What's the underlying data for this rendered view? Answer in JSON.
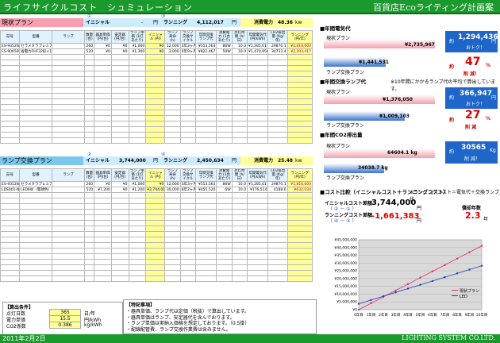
{
  "header": {
    "title": "ライフサイクルコスト　シュミュレーション",
    "right": "百貨店Ecoライティング計画案"
  },
  "footer": {
    "date": "2011年2月2日",
    "company": "LIGHTING SYSTEM CO.LTD."
  },
  "plan1": {
    "name": "現状プラン",
    "initial_label": "イニシャル",
    "initial_value": "-",
    "yen": "円",
    "running_label": "ランニング",
    "running_value": "4,112,017",
    "power_label": "消費電力",
    "power_value": "48.36",
    "kw": "kw",
    "c1": "①",
    "c3": "③",
    "headers": [
      "記号",
      "型番",
      "ランプ",
      "数量 (台)",
      "器具単価 (円/台)",
      "安定器 (円/台)",
      "ランプ単価 (1灯あたり)",
      "イニシャル (円)",
      "ランプ寿命 (h)",
      "ランプ 交換サイクル",
      "年間交換 ランプ代",
      "消費電力 (1台あたり)",
      "点灯時間 (h/日)",
      "年間電気代 (円/kWh)",
      "CO2排出量 (Kg/年)",
      "ランニング (円/年)"
    ],
    "rows": [
      [
        "ES-9352WA",
        "セラメタラプレミアS 70W×1",
        "260",
        "¥0",
        "¥0",
        "¥1,000",
        "¥0",
        "12,000",
        "3年3ヶ月",
        "¥553,563",
        "86W",
        "10.0",
        "¥1,285,017",
        "29870.1",
        "¥1,818,600"
      ],
      [
        "ES-9065B",
        "省電力FHF32形×1灯",
        "520",
        "¥0",
        "¥0",
        "¥1,300",
        "¥0",
        "3,000",
        "0年9ヶ月",
        "¥822,467",
        "50W",
        "10.0",
        "¥1,470,950",
        "34733.4",
        "¥2,293,417"
      ]
    ]
  },
  "plan2": {
    "name": "ランプ交換プラン",
    "initial_label": "イニシャル",
    "initial_value": "3,744,000",
    "yen": "円",
    "running_label": "ランニング",
    "running_value": "2,450,634",
    "power_label": "消費電力",
    "power_value": "25.48",
    "kw": "kw",
    "c2": "②",
    "c4": "④",
    "headers": [
      "記号",
      "型番",
      "ランプ",
      "数量 (台)",
      "器具単価 (円/台)",
      "安定器 (円/台)",
      "ランプ単価 (1灯あたり)",
      "イニシャル (円)",
      "ランプ寿命 (h)",
      "ランプ 交換サイクル",
      "年間交換 ランプ代",
      "消費電力 (1台あたり)",
      "点灯時間 (h/日)",
      "年間電気代 (円/kWh)",
      "CO2排出量 (Kg/年)",
      "ランニング (円/年)"
    ],
    "rows": [
      [
        "ES-9352WA",
        "セラメタラプレミアS 70W×1",
        "260",
        "¥0",
        "¥0",
        "¥1,000",
        "¥0",
        "12,000",
        "3年3ヶ月",
        "¥553,563",
        "86W",
        "10.0",
        "¥1,285,017",
        "29870.1",
        "¥1,818,600"
      ],
      [
        "LDS001-N-L20",
        "LED6W（電球色）",
        "520",
        "¥7,200",
        "¥0",
        "¥1,200",
        "¥3,744,000",
        "30,000",
        "8年2ヶ月",
        "¥455,520",
        "6W",
        "10.0",
        "¥176,514",
        "4188.6",
        "¥632,034"
      ]
    ]
  },
  "conditions": {
    "title": "【算出条件】",
    "items": [
      {
        "label": "点灯日数",
        "value": "365",
        "unit": "日/年"
      },
      {
        "label": "電力単価",
        "value": "15.5",
        "unit": "円/kWh"
      },
      {
        "label": "CO2係数",
        "value": "0.386",
        "unit": "kg/kWh"
      }
    ]
  },
  "notes": {
    "title": "【特記事項】",
    "lines": [
      "・器具単価、ランプ代は定価（税抜）で算出しています。",
      "・器具単価はランプ、安定器代を含んでおります。",
      "・ランプ単価は実納入価格を想定しております。（0.5掛）",
      "・配線配管費、ランプ交換作業費は含みません。"
    ]
  },
  "right": {
    "elec": {
      "title": "■年間電気代",
      "current_label": "現状プラン",
      "current_value": "¥2,735,967",
      "lamp_label": "ランプ交換プラン",
      "lamp_value": "¥1,441,531",
      "box_prefix": "約",
      "box_value": "1,294,436",
      "box_unit": "円",
      "box_sub": "おトク！",
      "pct_prefix": "約",
      "pct": "47",
      "pct_unit": "%",
      "pct_sub": "削 減！"
    },
    "lamp": {
      "title": "■年間交換ランプ代",
      "note": "※10年間にかかるランプ代の平均で算出しています。",
      "current_label": "現状プラン",
      "current_value": "¥1,376,050",
      "lamp_label": "ランプ交換プラン",
      "lamp_value": "¥1,009,103",
      "box_prefix": "約",
      "box_value": "366,947",
      "box_unit": "円",
      "box_sub": "おトク！",
      "pct_prefix": "約",
      "pct": "27",
      "pct_unit": "%",
      "pct_sub": "削 減"
    },
    "co2": {
      "title": "■年間CO2排出量",
      "current_label": "現状プラン",
      "current_value": "64604.1 kg",
      "lamp_label": "ランプ交換プラン",
      "lamp_value": "34038.7 kg",
      "box_prefix": "約",
      "box_value": "30565",
      "box_unit": "Kg",
      "box_sub": "削 減！"
    },
    "compare": {
      "title": "■コスト比較（イニシャルコスト＋ランニングコスト）",
      "note": "※ランニングコスト＝電気代＋交換ランプ代",
      "init_label": "イニシャルコスト差額",
      "init_sub": "（ ② － ① ）",
      "init_value": "3,744,000",
      "init_unit": "円",
      "run_label": "ランニングコスト差額",
      "run_sub": "（ ④ － ③ ）",
      "run_value": "-1,661,383",
      "run_unit": "円",
      "payback_label": "償却年数",
      "payback_value": "2.3",
      "payback_unit": "年"
    }
  },
  "chart_data": {
    "type": "line",
    "x": [
      "0年目",
      "1年目",
      "2年目",
      "3年目",
      "4年目",
      "5年目",
      "6年目",
      "7年目",
      "8年目",
      "9年目",
      "10年目"
    ],
    "yticks": [
      "¥45,000,000",
      "¥40,000,000",
      "¥35,000,000",
      "¥30,000,000",
      "¥25,000,000",
      "¥20,000,000",
      "¥15,000,000",
      "¥10,000,000",
      "¥5,000,000",
      "¥0"
    ],
    "ylim": [
      0,
      45000000
    ],
    "series": [
      {
        "name": "現状プラン",
        "color": "#e0306a",
        "values": [
          0,
          4112017,
          8224034,
          12336051,
          16448068,
          20560085,
          24672102,
          28784119,
          32896136,
          37008153,
          41120170
        ]
      },
      {
        "name": "LED",
        "color": "#1f3fbf",
        "values": [
          3744000,
          6194634,
          8645268,
          11095902,
          13546536,
          15997170,
          18447804,
          20898438,
          23349072,
          25799706,
          28250340
        ]
      }
    ]
  }
}
